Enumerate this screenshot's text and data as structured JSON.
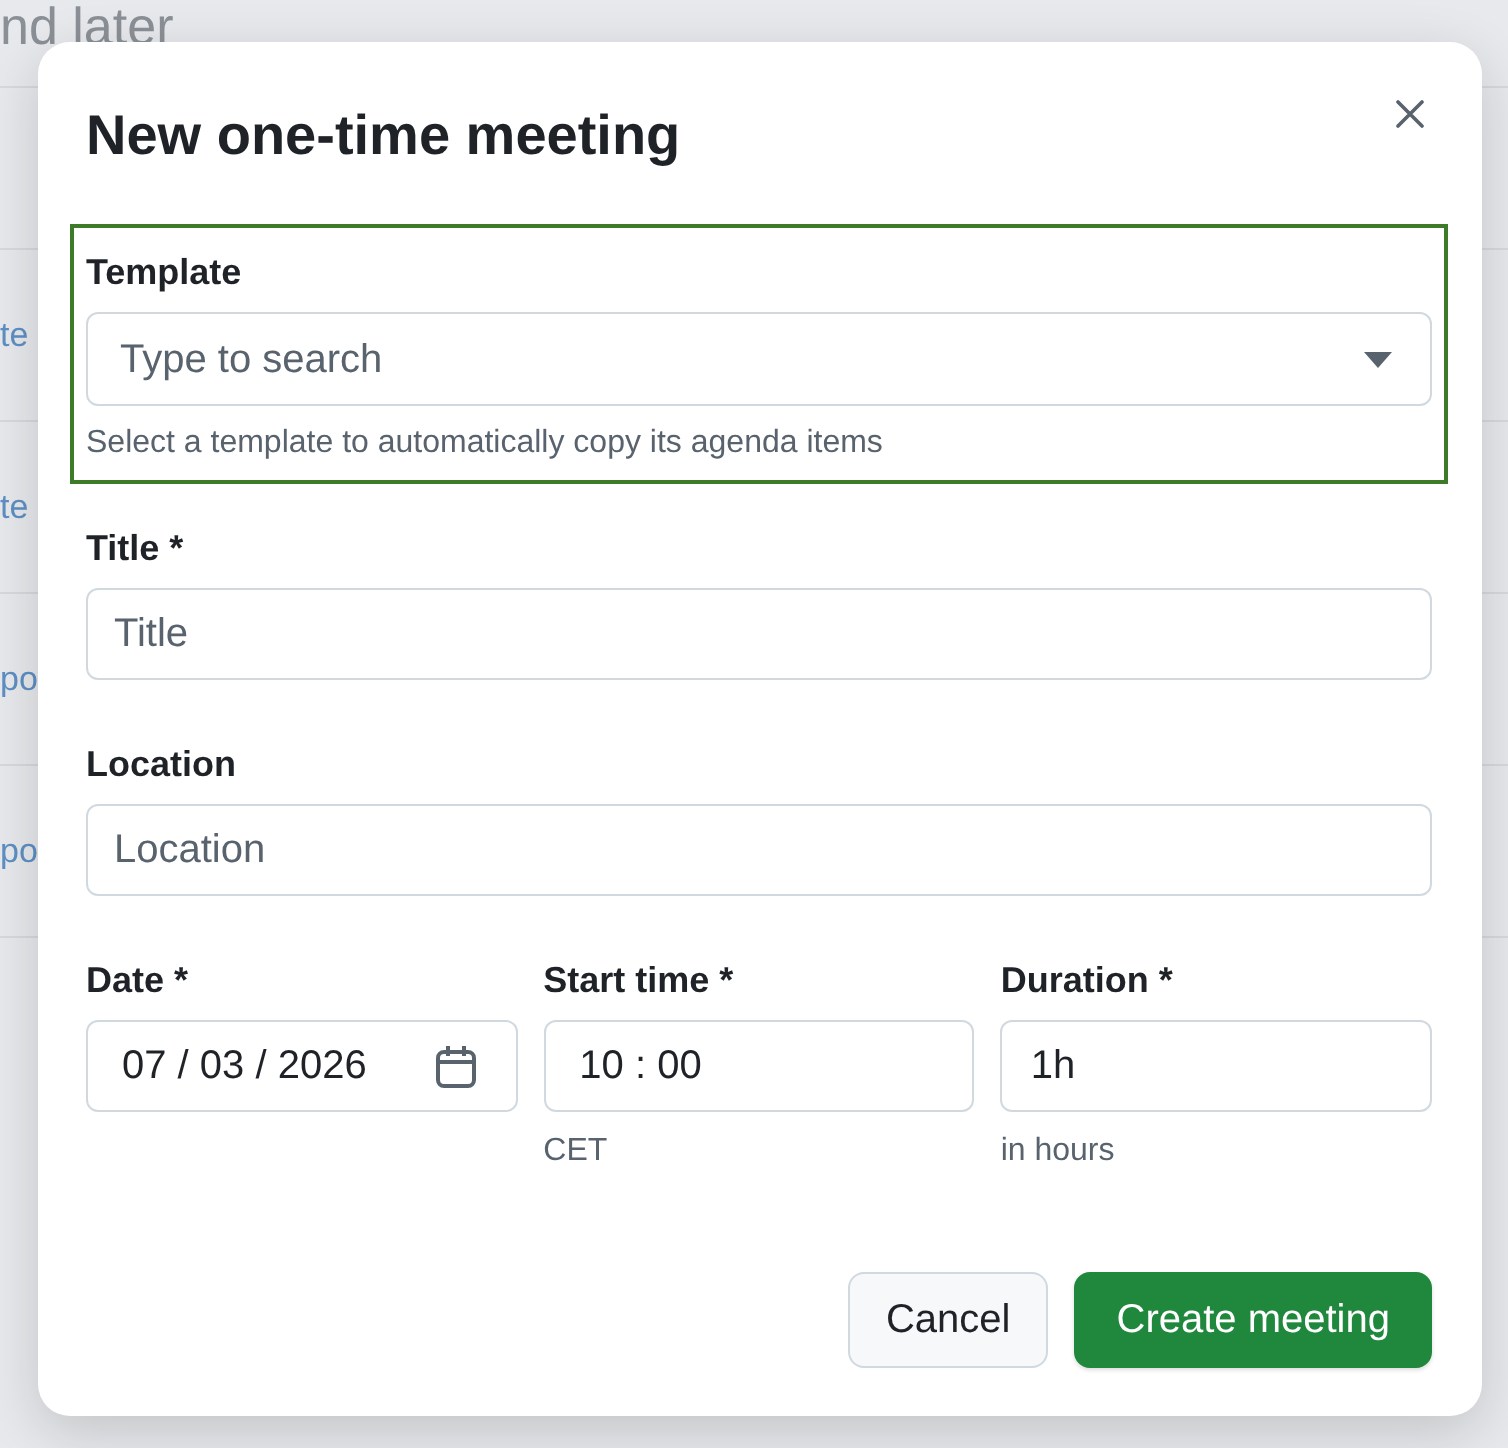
{
  "background": {
    "heading": "nd later",
    "rows": [
      "te",
      "te",
      "po",
      "po"
    ]
  },
  "dialog": {
    "title": "New one-time meeting",
    "template": {
      "label": "Template",
      "placeholder": "Type to search",
      "help": "Select a template to automatically copy its agenda items",
      "highlighted": true
    },
    "fields": [
      {
        "label": "Title *",
        "placeholder": "Title"
      },
      {
        "label": "Location",
        "placeholder": "Location"
      }
    ],
    "schedule": [
      {
        "kind": "date",
        "label": "Date *",
        "value": "07 / 03 / 2026"
      },
      {
        "kind": "time",
        "label": "Start time *",
        "value": "10 : 00",
        "help": "CET"
      },
      {
        "kind": "text",
        "label": "Duration *",
        "value": "1h",
        "help": "in hours"
      }
    ],
    "buttons": [
      {
        "kind": "secondary",
        "label": "Cancel"
      },
      {
        "kind": "primary",
        "label": "Create meeting"
      }
    ]
  }
}
